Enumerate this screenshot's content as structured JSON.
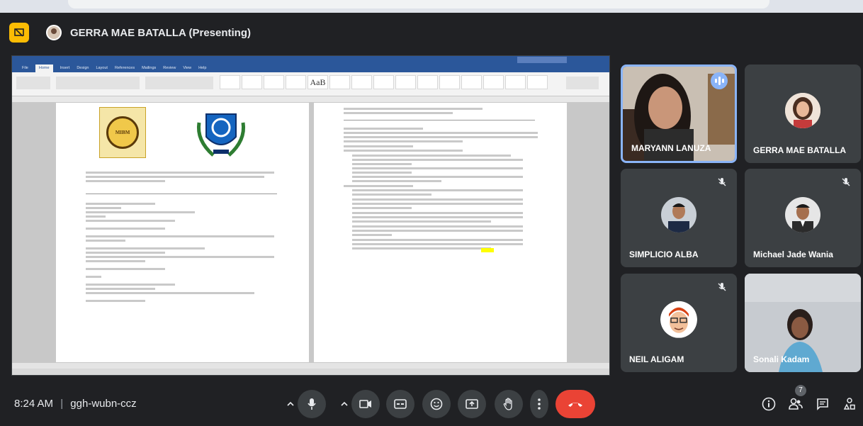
{
  "presenter": {
    "name": "GERRA MAE BATALLA (Presenting)"
  },
  "word": {
    "ribbon_tabs": [
      "File",
      "Home",
      "Insert",
      "Design",
      "Layout",
      "References",
      "Mailings",
      "Review",
      "View",
      "Help"
    ],
    "style_big": "AaB"
  },
  "participants": [
    {
      "name": "MARYANN LANUZA"
    },
    {
      "name": "GERRA MAE BATALLA"
    },
    {
      "name": "SIMPLICIO ALBA"
    },
    {
      "name": "Michael Jade Wania"
    },
    {
      "name": "NEIL ALIGAM"
    },
    {
      "name": "Sonali Kadam"
    }
  ],
  "meeting": {
    "time": "8:24 AM",
    "separator": "|",
    "code": "ggh-wubn-ccz",
    "people_count": "7"
  },
  "colors": {
    "background": "#202124",
    "tile": "#3c4043",
    "end_call": "#ea4335",
    "active_border": "#8ab4f8",
    "present_button": "#fbbc04"
  }
}
